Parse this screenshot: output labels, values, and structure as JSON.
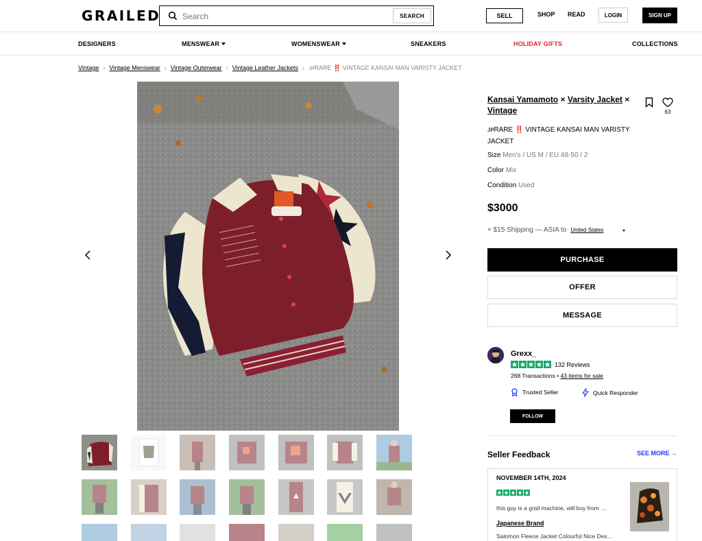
{
  "header": {
    "logo": "GRAILED",
    "search_placeholder": "Search",
    "search_button": "SEARCH",
    "sell": "SELL",
    "shop": "SHOP",
    "read": "READ",
    "login": "LOGIN",
    "signup": "SIGN UP"
  },
  "nav": {
    "designers": "DESIGNERS",
    "menswear": "MENSWEAR",
    "womenswear": "WOMENSWEAR",
    "sneakers": "SNEAKERS",
    "holiday": "HOLIDAY GIFTS",
    "collections": "COLLECTIONS"
  },
  "breadcrumb": {
    "c1": "Vintage",
    "c2": "Vintage Menswear",
    "c3": "Vintage Outerwear",
    "c4": "Vintage Leather Jackets",
    "current": "ᴊᴘRARE ‼️ VINTAGE KANSAI MAN VARISTY JACKET",
    "sep": "›"
  },
  "product": {
    "designer1": "Kansai Yamamoto",
    "designer2": "Varsity Jacket",
    "designer3": "Vintage",
    "x": "×",
    "likes": "63",
    "name": "ᴊᴘRARE ‼️ VINTAGE KANSAI MAN VARISTY JACKET",
    "size_label": "Size",
    "size_value": "Men's / US M / EU 48-50 / 2",
    "color_label": "Color",
    "color_value": "Mix",
    "condition_label": "Condition",
    "condition_value": "Used",
    "price": "$3000",
    "shipping": "+ $15 Shipping — ASIA to",
    "country": "United States",
    "purchase": "PURCHASE",
    "offer": "OFFER",
    "message": "MESSAGE"
  },
  "seller": {
    "name": "Grexx_",
    "reviews": "132 Reviews",
    "transactions": "268 Transactions",
    "bullet": "•",
    "items_for_sale": "43 items for sale",
    "trusted": "Trusted Seller",
    "quick": "Quick Responder",
    "follow": "FOLLOW"
  },
  "feedback": {
    "title": "Seller Feedback",
    "see_more": "SEE MORE →",
    "date": "NOVEMBER 14TH, 2024",
    "text": "this guy is a grail machine, will buy from …",
    "brand": "Japanese Brand",
    "item": "Salomon Fleece Jacket Colourful Nice Des…"
  },
  "colors": {
    "accent_red": "#e21d2c",
    "star_green": "#14a86b",
    "link_blue": "#1b3cff"
  }
}
